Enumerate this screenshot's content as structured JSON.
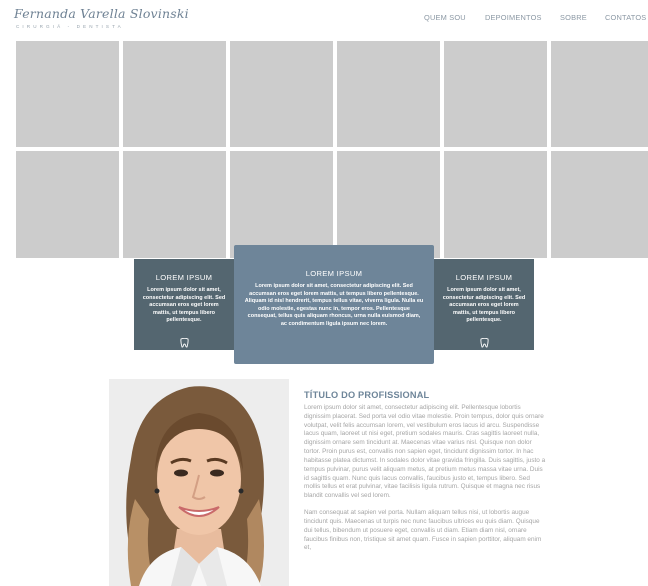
{
  "brand": {
    "name": "Fernanda Varella Slovinski",
    "subtitle": "CIRURGIÃ - DENTISTA"
  },
  "nav": {
    "items": [
      "QUEM SOU",
      "DEPOIMENTOS",
      "SOBRE",
      "CONTATOS"
    ]
  },
  "gallery": {
    "tile_color": "#cccccc"
  },
  "cards": {
    "left": {
      "title": "LOREM IPSUM",
      "text": "Lorem ipsum dolor sit amet, consectetur adipiscing elit. Sed accumsan eros eget lorem mattis, ut tempus libero pellentesque.",
      "icon": "tooth-icon"
    },
    "center": {
      "title": "LOREM IPSUM",
      "text": "Lorem ipsum dolor sit amet, consectetur adipiscing elit. Sed accumsan eros eget lorem mattis, ut tempus libero pellentesque. Aliquam id nisl hendrerit, tempus tellus vitae, viverra ligula. Nulla eu odio molestie, egestas nunc in, tempor eros. Pellentesque consequat, tellus quis aliquam rhoncus, urna nulla euismod diam, ac condimentum ligula ipsum nec lorem."
    },
    "right": {
      "title": "LOREM IPSUM",
      "text": "Lorem ipsum dolor sit amet, consectetur adipiscing elit. Sed accumsan eros eget lorem mattis, ut tempus libero pellentesque.",
      "icon": "tooth-icon"
    }
  },
  "profile": {
    "title": "TÍTULO DO PROFISSIONAL",
    "paragraph1": "Lorem ipsum dolor sit amet, consectetur adipiscing elit. Pellentesque lobortis dignissim placerat. Sed porta vel odio vitae molestie. Proin tempus, dolor quis ornare volutpat, velit felis accumsan lorem, vel vestibulum eros lacus id arcu. Suspendisse lacus quam, laoreet ut nisi eget, pretium sodales mauris. Cras sagittis laoreet nulla, dignissim ornare sem tincidunt at. Maecenas vitae varius nisl. Quisque non dolor tortor. Proin purus est, convallis non sapien eget, tincidunt dignissim tortor. In hac habitasse platea dictumst. In sodales dolor vitae gravida fringilla. Duis sagittis, justo a tempus pulvinar, purus velit aliquam metus, at pretium metus massa vitae urna. Duis id sagittis quam. Nunc quis lacus convallis, faucibus justo et, tempus libero. Sed mollis tellus et erat pulvinar, vitae facilisis ligula rutrum. Quisque et magna nec risus blandit convallis vel sed lorem.",
    "paragraph2": "Nam consequat at sapien vel porta. Nullam aliquam tellus nisi, ut lobortis augue tincidunt quis. Maecenas ut turpis nec nunc faucibus ultrices eu quis diam. Quisque dui tellus, bibendum ut posuere eget, convallis ut diam. Etiam diam nisl, ornare faucibus finibus non, tristique sit amet quam. Fusce in sapien porttitor, aliquam enim et,"
  },
  "colors": {
    "accent": "#6e8599",
    "card_dark": "#546670",
    "nav_text": "#8b98a4",
    "body_text": "#a5a5a5"
  }
}
